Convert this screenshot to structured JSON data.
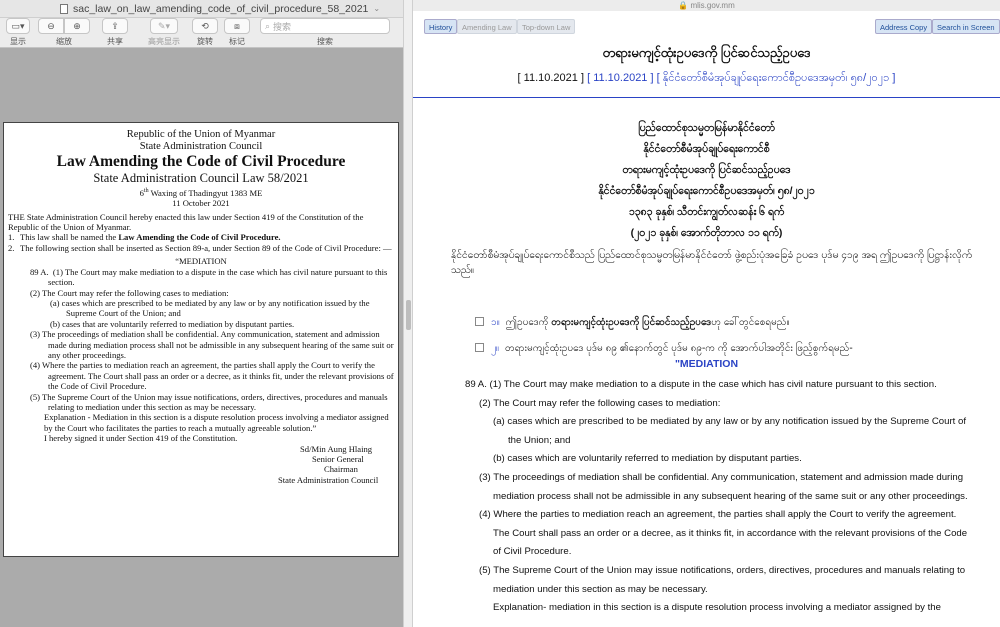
{
  "left_window": {
    "title": "sac_law_on_law_amending_code_of_civil_procedure_58_2021",
    "toolbar": {
      "display": "显示",
      "zoom": "缩放",
      "share": "共享",
      "highlight": "高亮显示",
      "rotate": "旋转",
      "markup": "标记",
      "search_placeholder": "搜索",
      "search_label": "搜索"
    },
    "document": {
      "line1": "Republic of the Union of Myanmar",
      "line2": "State Administration Council",
      "title": "Law Amending the Code of Civil Procedure",
      "subtitle": "State Administration Council Law 58/2021",
      "waxing_day": "6",
      "waxing_sup": "th",
      "waxing_rest": " Waxing of Thadingyut 1383 ME",
      "date": "11 October 2021",
      "enact": "THE State Administration Council hereby enacted this law under Section 419 of the Constitution of the Republic of the Union of Myanmar.",
      "item1_num": "1.",
      "item1_pre": "This law shall be named the ",
      "item1_bold": "Law Amending the Code of Civil Procedure.",
      "item2_num": "2.",
      "item2": "The following section shall be inserted as Section 89-a, under Section 89 of the Code of Civil Procedure: —",
      "med_head": "“MEDIATION",
      "s89_label": "89 A.",
      "p1": "(1)  The Court may make mediation to a dispute in the case which has civil nature pursuant to this section.",
      "p2": "(2)  The Court may refer the following cases to mediation:",
      "p2a": "(a)   cases which are prescribed to be mediated by any law or by any notification issued by the Supreme Court of the Union; and",
      "p2b": "(b)   cases that are voluntarily referred to mediation by disputant parties.",
      "p3": "(3)  The proceedings of mediation shall be confidential. Any communication, statement and admission made during mediation process shall not be admissible in any subsequent hearing of the same suit or any other proceedings.",
      "p4": "(4)  Where the parties to mediation reach an agreement, the parties shall apply the Court to verify the agreement. The Court shall pass an order or a decree, as it thinks fit, under the relevant provisions of the Code of Civil Procedure.",
      "p5": "(5)  The Supreme Court of the Union may issue notifications, orders, directives, procedures and manuals relating to mediation under this section as may be necessary.",
      "explanation": "Explanation - Mediation in this section is a dispute resolution process involving a mediator assigned by the Court who facilitates the parties to reach a mutually agreeable solution.”",
      "signed": "I hereby signed it under Section 419 of the Constitution.",
      "sig1": "Sd/Min Aung Hlaing",
      "sig2": "Senior General",
      "sig3": "Chairman",
      "sig4": "State Administration Council"
    }
  },
  "right_window": {
    "url": "mlis.gov.mm",
    "buttons": {
      "history": "History",
      "amending_law": "Amending Law",
      "top_down_law": "Top-down Law",
      "address_copy": "Address Copy",
      "search_in_screen": "Search in Screen"
    },
    "law_title": "တရားမကျင့်ထုံးဥပဒေကို ပြင်ဆင်သည့်ဥပဒေ",
    "date_open": "[ 11.10.2021 ]",
    "date_link": "[ 11.10.2021 ]",
    "law_number_link": "[ နိုင်ငံတော်စီမံအုပ်ချုပ်ရေးကောင်စီဥပဒေအမှတ်၊ ၅၈/၂၀၂၁ ]",
    "header_lines": [
      "ပြည်ထောင်စုသမ္မတမြန်မာနိုင်ငံတော်",
      "နိုင်ငံတော်စီမံအုပ်ချုပ်ရေးကောင်စီ",
      "တရားမကျင့်ထုံးဥပဒေကို ပြင်ဆင်သည့်ဥပဒေ",
      "နိုင်ငံတော်စီမံအုပ်ချုပ်ရေးကောင်စီဥပဒေအမှတ်၊ ၅၈/၂၀၂၁",
      "၁၃၈၃ ခုနှစ်၊ သီတင်းကျွတ်လဆန်း ၆ ရက်",
      "(၂၀၂၁ ခုနှစ်၊ အောက်တိုဘာလ ၁၁ ရက်)"
    ],
    "preamble": "နိုင်ငံတော်စီမံအုပ်ချုပ်ရေးကောင်စီသည် ပြည်ထောင်စုသမ္မတမြန်မာနိုင်ငံတော် ဖွဲ့စည်းပုံအခြေခံ ဥပဒေ ပုဒ်မ ၄၁၉ အရ ဤဥပဒေကို ပြဋ္ဌာန်းလိုက်သည်။",
    "sec1_num": "၁။",
    "sec1_pre": "ဤဥပဒေကို ",
    "sec1_bold": "တရားမကျင့်ထုံးဥပဒေကို ပြင်ဆင်သည့်ဥပဒေ",
    "sec1_post": "ဟု ခေါ်တွင်စေရမည်။",
    "sec2_num": "၂။",
    "sec2": "တရားမကျင့်ထုံးဥပဒေ ပုဒ်မ ၈၉ ၏နောက်တွင် ပုဒ်မ ၈၉-က ကို အောက်ပါအတိုင်း ဖြည့်စွက်ရမည်-",
    "mediation_heading": "\"MEDIATION",
    "english": [
      "89 A. (1) The Court may make mediation to a dispute in the case which has civil nature pursuant to this section.",
      "(2) The Court may refer the following cases to mediation:",
      "(a) cases which are prescribed to be mediated by any law or by any notification issued by the Supreme Court of",
      "the Union; and",
      "(b) cases which are voluntarily referred to mediation by disputant parties.",
      "(3) The proceedings of mediation shall be confidential. Any communication, statement and admission made during",
      "mediation process shall not be admissible in any subsequent hearing of the same suit or any other proceedings.",
      "(4) Where the parties to mediation reach an agreement, the parties shall apply the Court to verify the agreement.",
      "The Court shall pass an order or a decree, as it thinks fit, in accordance with the relevant provisions of the Code",
      "of Civil Procedure.",
      "(5) The Supreme Court of the Union may issue notifications, orders, directives, procedures and manuals relating to",
      "mediation under this section as may be necessary.",
      "Explanation- mediation in this section is a dispute resolution process involving a mediator assigned by the"
    ]
  }
}
